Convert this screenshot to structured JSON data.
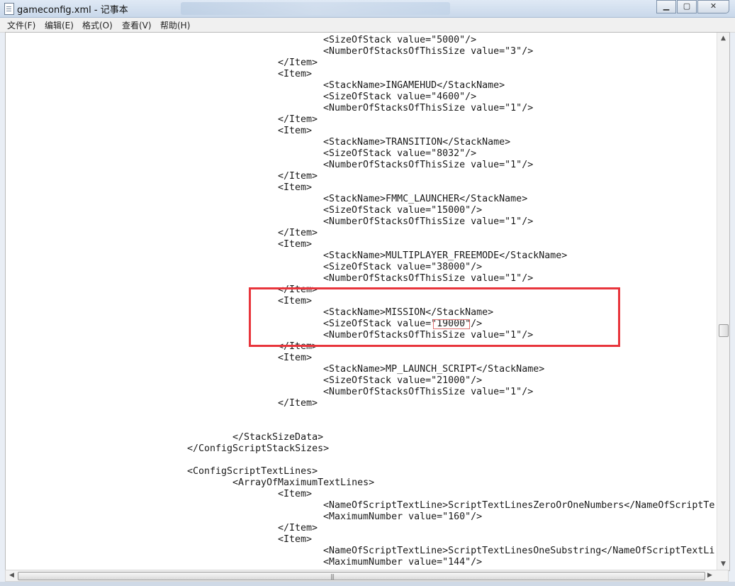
{
  "window": {
    "title": "gameconfig.xml - 记事本",
    "minimize": "▁",
    "maximize": "▢",
    "close": "✕"
  },
  "menu": [
    "文件(F)",
    "编辑(E)",
    "格式(O)",
    "查看(V)",
    "帮助(H)"
  ],
  "lines": [
    {
      "indent": 448,
      "text": "<SizeOfStack value=\"5000\"/>"
    },
    {
      "indent": 448,
      "text": "<NumberOfStacksOfThisSize value=\"3\"/>"
    },
    {
      "indent": 384,
      "text": "</Item>"
    },
    {
      "indent": 384,
      "text": "<Item>"
    },
    {
      "indent": 448,
      "text": "<StackName>INGAMEHUD</StackName>"
    },
    {
      "indent": 448,
      "text": "<SizeOfStack value=\"4600\"/>"
    },
    {
      "indent": 448,
      "text": "<NumberOfStacksOfThisSize value=\"1\"/>"
    },
    {
      "indent": 384,
      "text": "</Item>"
    },
    {
      "indent": 384,
      "text": "<Item>"
    },
    {
      "indent": 448,
      "text": "<StackName>TRANSITION</StackName>"
    },
    {
      "indent": 448,
      "text": "<SizeOfStack value=\"8032\"/>"
    },
    {
      "indent": 448,
      "text": "<NumberOfStacksOfThisSize value=\"1\"/>"
    },
    {
      "indent": 384,
      "text": "</Item>"
    },
    {
      "indent": 384,
      "text": "<Item>"
    },
    {
      "indent": 448,
      "text": "<StackName>FMMC_LAUNCHER</StackName>"
    },
    {
      "indent": 448,
      "text": "<SizeOfStack value=\"15000\"/>"
    },
    {
      "indent": 448,
      "text": "<NumberOfStacksOfThisSize value=\"1\"/>"
    },
    {
      "indent": 384,
      "text": "</Item>"
    },
    {
      "indent": 384,
      "text": "<Item>"
    },
    {
      "indent": 448,
      "text": "<StackName>MULTIPLAYER_FREEMODE</StackName>"
    },
    {
      "indent": 448,
      "text": "<SizeOfStack value=\"38000\"/>"
    },
    {
      "indent": 448,
      "text": "<NumberOfStacksOfThisSize value=\"1\"/>"
    },
    {
      "indent": 384,
      "text": "</Item>"
    },
    {
      "indent": 384,
      "text": "<Item>"
    },
    {
      "indent": 448,
      "text": "<StackName>MISSION</StackName>"
    },
    {
      "indent": 448,
      "text": "<SizeOfStack value=\"19000\"/>"
    },
    {
      "indent": 448,
      "text": "<NumberOfStacksOfThisSize value=\"1\"/>"
    },
    {
      "indent": 384,
      "text": "</Item>"
    },
    {
      "indent": 384,
      "text": "<Item>"
    },
    {
      "indent": 448,
      "text": "<StackName>MP_LAUNCH_SCRIPT</StackName>"
    },
    {
      "indent": 448,
      "text": "<SizeOfStack value=\"21000\"/>"
    },
    {
      "indent": 448,
      "text": "<NumberOfStacksOfThisSize value=\"1\"/>"
    },
    {
      "indent": 384,
      "text": "</Item>"
    },
    {
      "indent": 0,
      "text": ""
    },
    {
      "indent": 0,
      "text": ""
    },
    {
      "indent": 320,
      "text": "</StackSizeData>"
    },
    {
      "indent": 256,
      "text": "</ConfigScriptStackSizes>"
    },
    {
      "indent": 0,
      "text": ""
    },
    {
      "indent": 256,
      "text": "<ConfigScriptTextLines>"
    },
    {
      "indent": 320,
      "text": "<ArrayOfMaximumTextLines>"
    },
    {
      "indent": 384,
      "text": "<Item>"
    },
    {
      "indent": 448,
      "text": "<NameOfScriptTextLine>ScriptTextLinesZeroOrOneNumbers</NameOfScriptTe"
    },
    {
      "indent": 448,
      "text": "<MaximumNumber value=\"160\"/>"
    },
    {
      "indent": 384,
      "text": "</Item>"
    },
    {
      "indent": 384,
      "text": "<Item>"
    },
    {
      "indent": 448,
      "text": "<NameOfScriptTextLine>ScriptTextLinesOneSubstring</NameOfScriptTextLi"
    },
    {
      "indent": 448,
      "text": "<MaximumNumber value=\"144\"/>"
    }
  ],
  "scrollbar": {
    "up": "▲",
    "down": "▼",
    "left": "◀",
    "right": "▶",
    "grip": "|||"
  }
}
